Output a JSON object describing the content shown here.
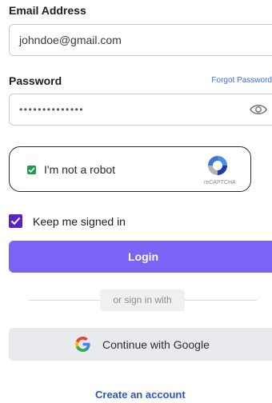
{
  "email": {
    "label": "Email Address",
    "value": "johndoe@gmail.com"
  },
  "password": {
    "label": "Password",
    "masked_value": "••••••••••••••",
    "forgot_link": "Forgot Password"
  },
  "captcha": {
    "label": "I'm not a robot",
    "brand": "reCAPTCHA",
    "checked": true
  },
  "keep_signed_in": {
    "label": "Keep me signed in",
    "checked": true
  },
  "login_button": "Login",
  "divider_text": "or sign in with",
  "google_button": "Continue with Google",
  "create_account": "Create an account",
  "colors": {
    "primary_button": "#7a63f5",
    "checkbox": "#5b22c6",
    "captcha_check": "#1e9b4c",
    "link": "#3b6fd6"
  }
}
